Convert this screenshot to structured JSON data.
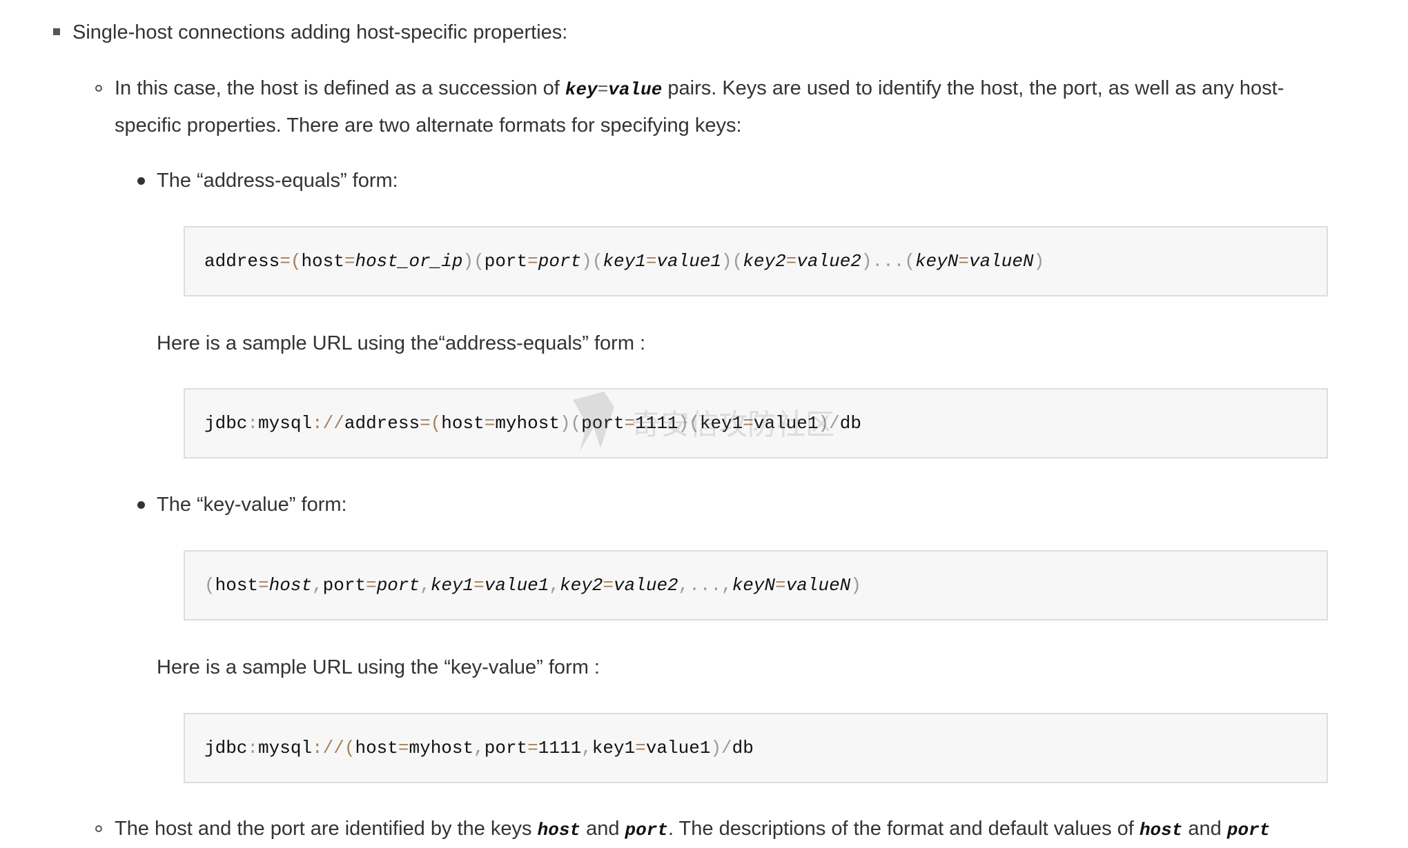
{
  "items": {
    "single_host": "Single-host connections adding host-specific properties:",
    "case_pre": "In this case, the host is defined as a succession of ",
    "case_key": "key",
    "case_eq": "=",
    "case_value": "value",
    "case_post": " pairs. Keys are used to identify the host, the port, as well as any host-",
    "case_line2": "specific properties. There are two alternate formats for specifying keys:",
    "addr_eq_form": "The “address-equals” form:",
    "addr_sample": "Here is a sample URL using the“address-equals” form :",
    "kv_form": "The “key-value” form:",
    "kv_sample": "Here is a sample URL using the “key-value” form :",
    "last_pre": "The host and the port are identified by the keys ",
    "last_host": "host",
    "last_and": " and ",
    "last_port": "port",
    "last_mid": ". The descriptions of the format and default values of ",
    "last_host2": "host",
    "last_and2": " and ",
    "last_port2": "port"
  },
  "code": {
    "b1": {
      "t1": "address",
      "t2": "=(",
      "t3": "host",
      "t4": "=",
      "t5": "host_or_ip",
      "t6": ")(",
      "t7": "port",
      "t8": "=",
      "t9": "port",
      "t10": ")(",
      "t11": "key1",
      "t12": "=",
      "t13": "value1",
      "t14": ")(",
      "t15": "key2",
      "t16": "=",
      "t17": "value2",
      "t18": ")...(",
      "t19": "keyN",
      "t20": "=",
      "t21": "valueN",
      "t22": ")"
    },
    "b2": {
      "t1": "jdbc",
      "t2": ":",
      "t3": "mysql",
      "t4": "://",
      "t5": "address",
      "t6": "=(",
      "t7": "host",
      "t8": "=",
      "t9": "myhost",
      "t10": ")(",
      "t11": "port",
      "t12": "=",
      "t13": "1111",
      "t14": ")(",
      "t15": "key1",
      "t16": "=",
      "t17": "value1",
      "t18": ")/",
      "t19": "db"
    },
    "b3": {
      "t1": "(",
      "t2": "host",
      "t3": "=",
      "t4": "host",
      "t5": ",",
      "t6": "port",
      "t7": "=",
      "t8": "port",
      "t9": ",",
      "t10": "key1",
      "t11": "=",
      "t12": "value1",
      "t13": ",",
      "t14": "key2",
      "t15": "=",
      "t16": "value2",
      "t17": ",...,",
      "t18": "keyN",
      "t19": "=",
      "t20": "valueN",
      "t21": ")"
    },
    "b4": {
      "t1": "jdbc",
      "t2": ":",
      "t3": "mysql",
      "t4": "://(",
      "t5": "host",
      "t6": "=",
      "t7": "myhost",
      "t8": ",",
      "t9": "port",
      "t10": "=",
      "t11": "1111",
      "t12": ",",
      "t13": "key1",
      "t14": "=",
      "t15": "value1",
      "t16": ")/",
      "t17": "db"
    }
  },
  "watermark_icon": "shield-logo-icon",
  "watermark_text": "奇安信攻防社区"
}
